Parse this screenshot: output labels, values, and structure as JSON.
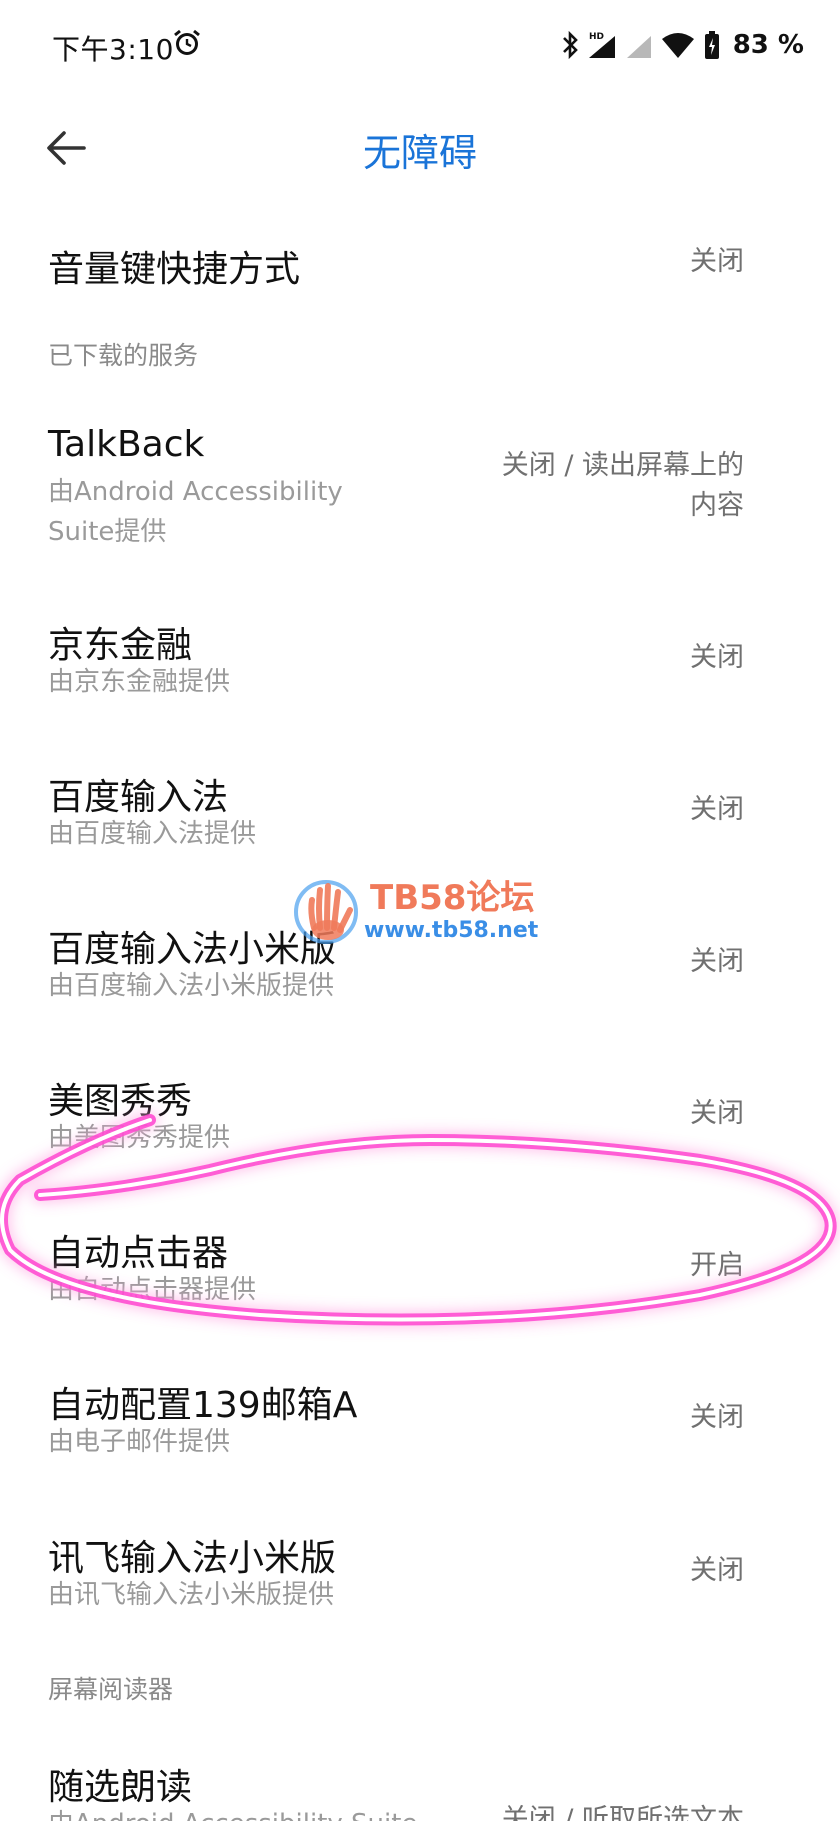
{
  "status_bar": {
    "time": "下午3:10",
    "battery": "83 %",
    "icons": [
      "alarm-icon",
      "bluetooth-icon",
      "signal-hd-icon",
      "signal-icon",
      "wifi-icon",
      "battery-icon"
    ]
  },
  "header": {
    "title": "无障碍",
    "back_icon": "arrow-left-icon",
    "title_color": "#1a74d8"
  },
  "volume_shortcut": {
    "title": "音量键快捷方式",
    "status": "关闭"
  },
  "sections": {
    "downloaded": "已下载的服务",
    "screen_reader": "屏幕阅读器"
  },
  "services": [
    {
      "title": "TalkBack",
      "subtitle_line1": "由Android Accessibility",
      "subtitle_line2": "Suite提供",
      "status_line1": "关闭 / 读出屏幕上的",
      "status_line2": "内容"
    },
    {
      "title": "京东金融",
      "subtitle": "由京东金融提供",
      "status": "关闭"
    },
    {
      "title": "百度输入法",
      "subtitle": "由百度输入法提供",
      "status": "关闭"
    },
    {
      "title": "百度输入法小米版",
      "subtitle": "由百度输入法小米版提供",
      "status": "关闭"
    },
    {
      "title": "美图秀秀",
      "subtitle": "由美图秀秀提供",
      "status": "关闭"
    },
    {
      "title": "自动点击器",
      "subtitle": "由自动点击器提供",
      "status": "开启"
    },
    {
      "title": "自动配置139邮箱A",
      "subtitle": "由电子邮件提供",
      "status": "关闭"
    },
    {
      "title": "讯飞输入法小米版",
      "subtitle": "由讯飞输入法小米版提供",
      "status": "关闭"
    }
  ],
  "screen_reader_items": [
    {
      "title": "随选朗读",
      "subtitle": "由Android Accessibility Suite",
      "status": "关闭 / 听取所选文本"
    }
  ],
  "watermark": {
    "title": "TB58论坛",
    "url": "www.tb58.net"
  },
  "annotation": {
    "color": "#ff3fd0",
    "target": "自动点击器"
  }
}
